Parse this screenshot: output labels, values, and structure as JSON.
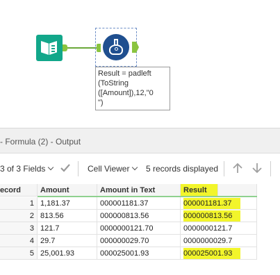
{
  "canvas": {
    "annotation_text": "Result = padleft\n(ToString\n([Amount]),12,\"0\n\")"
  },
  "results": {
    "panel_title": "- Formula (2) - Output",
    "fields_selector": "3 of 3 Fields",
    "cell_viewer": "Cell Viewer",
    "records_info": "5 records displayed",
    "columns": [
      "ecord",
      "Amount",
      "Amount in Text",
      "Result"
    ],
    "rows": [
      {
        "record": "1",
        "amount": "1,181.37",
        "amount_text": "000001181.37",
        "result": "000001181.37"
      },
      {
        "record": "2",
        "amount": "813.56",
        "amount_text": "000000813.56",
        "result": "000000813.56"
      },
      {
        "record": "3",
        "amount": "121.7",
        "amount_text": "0000000121.70",
        "result": "0000000121.7"
      },
      {
        "record": "4",
        "amount": "29.7",
        "amount_text": "000000029.70",
        "result": "0000000029.7"
      },
      {
        "record": "5",
        "amount": "25,001.93",
        "amount_text": "000025001.93",
        "result": "000025001.93"
      }
    ],
    "highlighted_result_rows": [
      1,
      2,
      5
    ]
  },
  "colors": {
    "highlight": "#f2f52b",
    "input_tool": "#12a78a",
    "formula_tool": "#1f4f8f",
    "connector": "#6aa839"
  }
}
